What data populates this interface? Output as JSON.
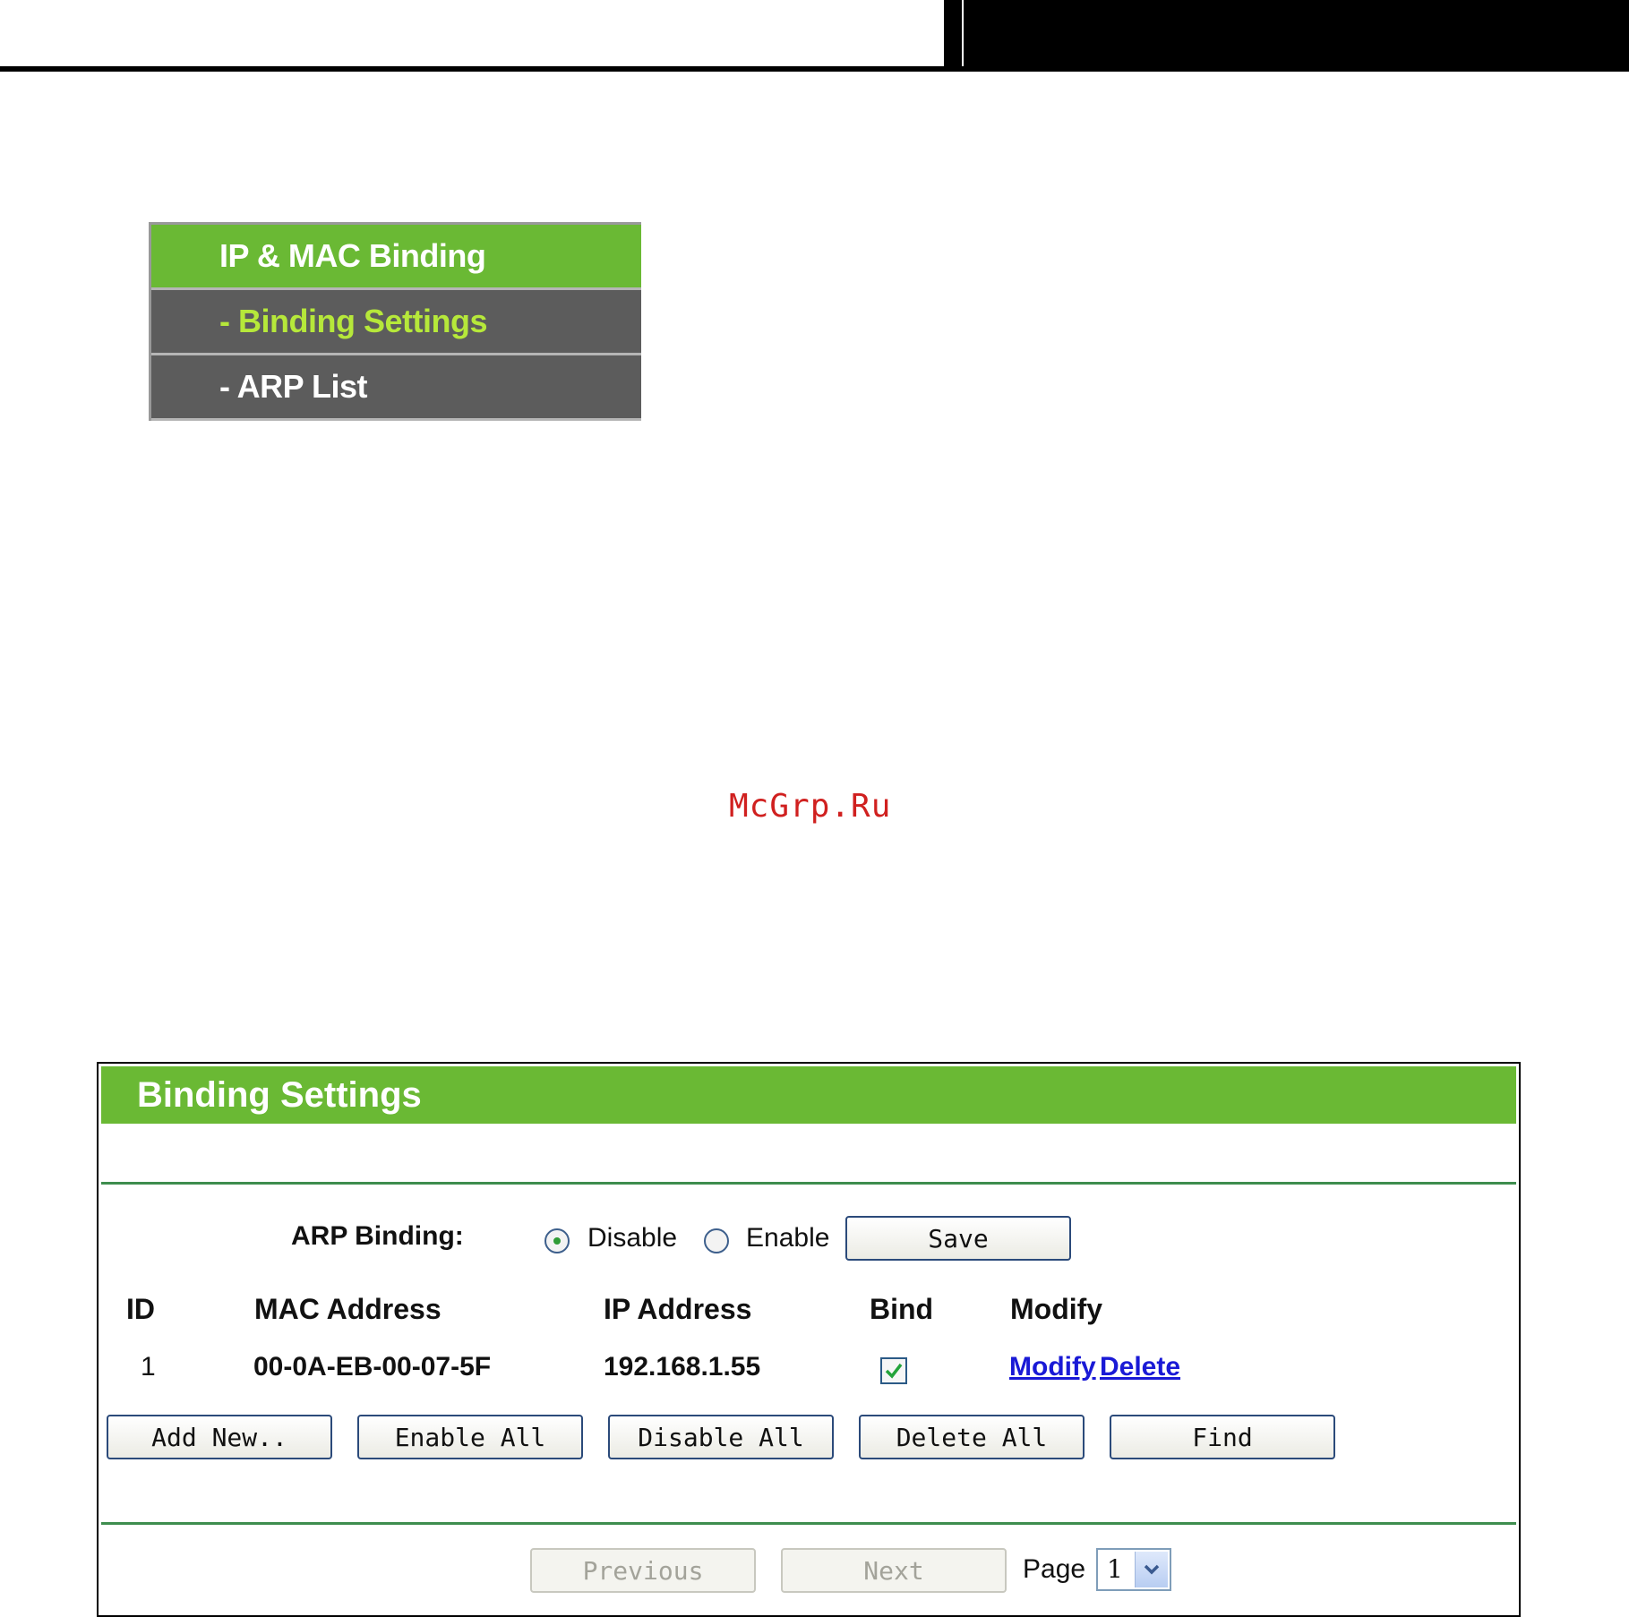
{
  "menu": {
    "title": "IP & MAC Binding",
    "items": [
      {
        "label": "- Binding Settings",
        "active": true
      },
      {
        "label": "- ARP List",
        "active": false
      }
    ]
  },
  "watermark": "McGrp.Ru",
  "panel": {
    "title": "Binding Settings",
    "arp_binding": {
      "label": "ARP Binding:",
      "options": [
        "Disable",
        "Enable"
      ],
      "selected": "Disable",
      "save_label": "Save"
    },
    "table": {
      "headers": [
        "ID",
        "MAC Address",
        "IP Address",
        "Bind",
        "Modify"
      ],
      "rows": [
        {
          "id": "1",
          "mac": "00-0A-EB-00-07-5F",
          "ip": "192.168.1.55",
          "bind": true,
          "modify_label": "Modify",
          "delete_label": "Delete"
        }
      ]
    },
    "actions": [
      "Add New..",
      "Enable All",
      "Disable All",
      "Delete All",
      "Find"
    ],
    "pagination": {
      "previous_label": "Previous",
      "next_label": "Next",
      "page_label": "Page",
      "page_value": "1"
    }
  },
  "colors": {
    "accent_green": "#6ab934",
    "menu_dark": "#5c5c5c",
    "active_text": "#b6e83a",
    "link": "#1a1ad6",
    "watermark": "#d0201f"
  }
}
